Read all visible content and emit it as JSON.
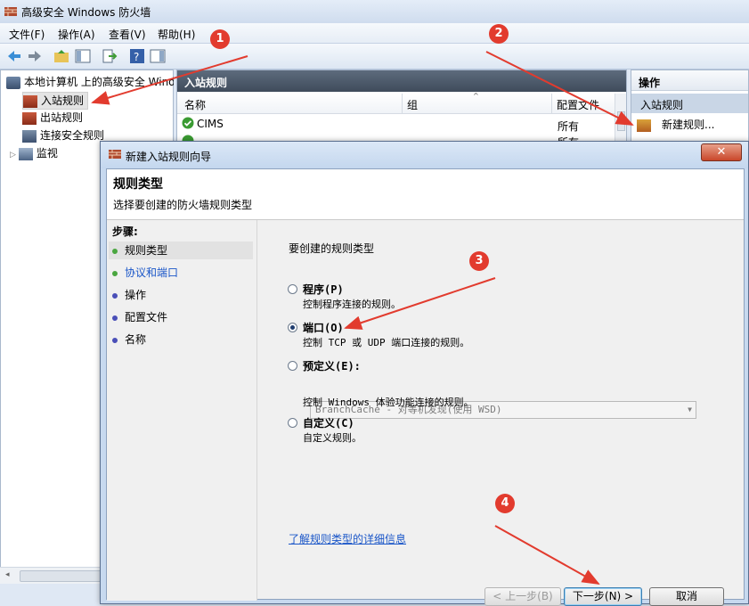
{
  "window": {
    "title": "高级安全 Windows 防火墙"
  },
  "menu": [
    "文件(F)",
    "操作(A)",
    "查看(V)",
    "帮助(H)"
  ],
  "tree": {
    "root": "本地计算机 上的高级安全 Windows",
    "items": [
      "入站规则",
      "出站规则",
      "连接安全规则",
      "监视"
    ]
  },
  "middle": {
    "header": "入站规则",
    "columns": [
      "名称",
      "组",
      "配置文件"
    ],
    "rows": [
      {
        "name": "CIMS",
        "profile": "所有"
      },
      {
        "name": "",
        "profile": "所有"
      }
    ]
  },
  "actions": {
    "header": "操作",
    "section": "入站规则",
    "new_rule": "新建规则..."
  },
  "dialog": {
    "title": "新建入站规则向导",
    "heading": "规则类型",
    "subheading": "选择要创建的防火墙规则类型",
    "steps_label": "步骤:",
    "steps": [
      {
        "label": "规则类型",
        "color": "#4aa640"
      },
      {
        "label": "协议和端口",
        "color": "#4aa640"
      },
      {
        "label": "操作",
        "color": "#4a4fb8"
      },
      {
        "label": "配置文件",
        "color": "#4a4fb8"
      },
      {
        "label": "名称",
        "color": "#4a4fb8"
      }
    ],
    "prompt": "要创建的规则类型",
    "options": [
      {
        "label": "程序(P)",
        "desc": "控制程序连接的规则。",
        "selected": false
      },
      {
        "label": "端口(O)",
        "desc": "控制 TCP 或 UDP 端口连接的规则。",
        "selected": true
      },
      {
        "label": "预定义(E):",
        "desc": "控制 Windows 体验功能连接的规则。",
        "selected": false
      },
      {
        "label": "自定义(C)",
        "desc": "自定义规则。",
        "selected": false
      }
    ],
    "predefined_value": "BranchCache - 对等机发现(使用 WSD)",
    "learn_more": "了解规则类型的详细信息",
    "buttons": {
      "back": "< 上一步(B)",
      "next": "下一步(N) >",
      "cancel": "取消"
    }
  },
  "annotations": [
    "1",
    "2",
    "3",
    "4"
  ],
  "colors": {
    "arrow": "#e23b2e",
    "link": "#1a56c8",
    "header_dark": "#4a5667"
  }
}
